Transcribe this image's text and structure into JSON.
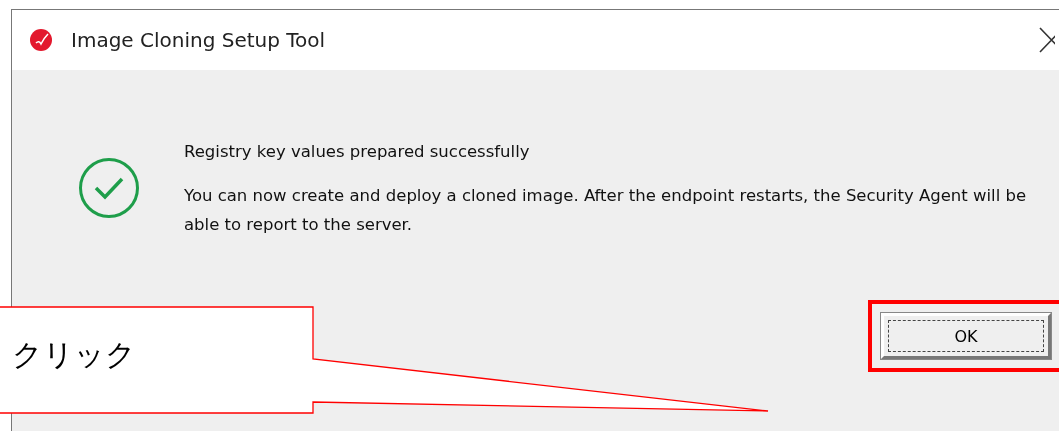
{
  "window": {
    "title": "Image Cloning Setup Tool"
  },
  "message": {
    "heading": "Registry key values prepared successfully",
    "body": "You can now create and deploy a cloned image. After the endpoint restarts, the Security Agent will be able to report to the server."
  },
  "buttons": [
    {
      "label": "OK",
      "highlighted": true
    }
  ],
  "callout": {
    "text": "クリック"
  }
}
